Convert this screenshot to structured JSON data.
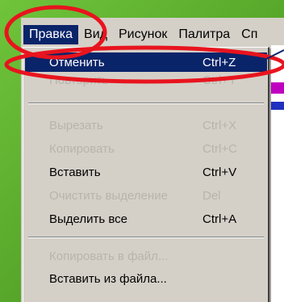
{
  "menubar": {
    "items": [
      {
        "label": "Правка"
      },
      {
        "label": "Вид"
      },
      {
        "label": "Рисунок"
      },
      {
        "label": "Палитра"
      },
      {
        "label": "Сп"
      }
    ]
  },
  "edit_menu": {
    "items": [
      {
        "label": "Отменить",
        "shortcut": "Ctrl+Z",
        "state": "highlighted"
      },
      {
        "label": "Повторить",
        "shortcut": "Ctrl+Y",
        "state": "disabled"
      },
      {
        "label": "Вырезать",
        "shortcut": "Ctrl+X",
        "state": "disabled"
      },
      {
        "label": "Копировать",
        "shortcut": "Ctrl+C",
        "state": "disabled"
      },
      {
        "label": "Вставить",
        "shortcut": "Ctrl+V",
        "state": "enabled"
      },
      {
        "label": "Очистить выделение",
        "shortcut": "Del",
        "state": "disabled"
      },
      {
        "label": "Выделить все",
        "shortcut": "Ctrl+A",
        "state": "enabled"
      },
      {
        "label": "Копировать в файл...",
        "shortcut": "",
        "state": "disabled"
      },
      {
        "label": "Вставить из файла...",
        "shortcut": "",
        "state": "enabled"
      }
    ]
  },
  "colors": {
    "background_green": "#5bb02e",
    "menu_highlight": "#0a246a",
    "annotation_red": "#e8141e",
    "palette_magenta": "#c000c0"
  }
}
